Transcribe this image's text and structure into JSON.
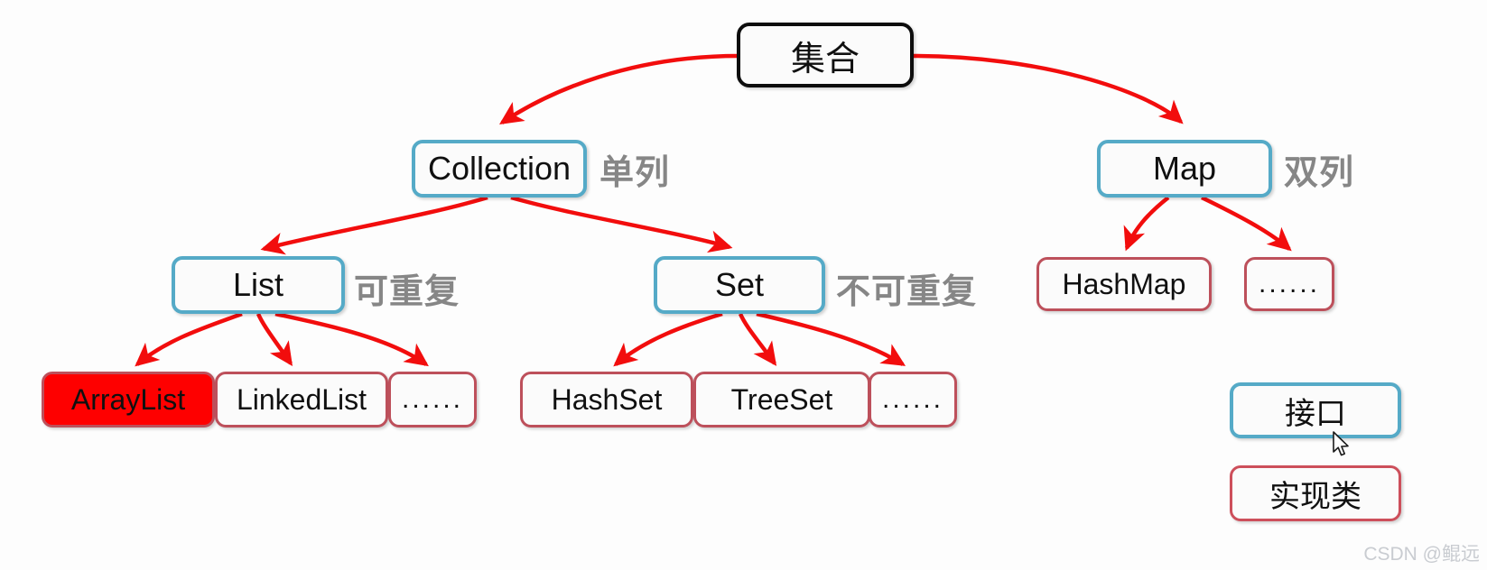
{
  "diagram": {
    "title_node": {
      "label": "集合"
    },
    "nodes": {
      "collection": "Collection",
      "map": "Map",
      "list": "List",
      "set": "Set",
      "hashmap": "HashMap",
      "map_ellipsis": "......",
      "arraylist": "ArrayList",
      "linkedlist": "LinkedList",
      "list_ellipsis": "......",
      "hashset": "HashSet",
      "treeset": "TreeSet",
      "set_ellipsis": "......"
    },
    "annotations": {
      "collection_note": "单列",
      "map_note": "双列",
      "list_note": "可重复",
      "set_note": "不可重复"
    },
    "legend": {
      "interface": "接口",
      "implementation": "实现类"
    },
    "colors": {
      "root_border": "#0d0d0d",
      "interface_border": "#55aac7",
      "implementation_border": "#bd505b",
      "highlight_fill": "#fe0000",
      "arrow": "#f20d0d",
      "annotation_text": "#868686",
      "watermark_text": "#c9ccd1",
      "node_fill": "#fbfbfb"
    },
    "watermark": "CSDN @鲲远"
  }
}
